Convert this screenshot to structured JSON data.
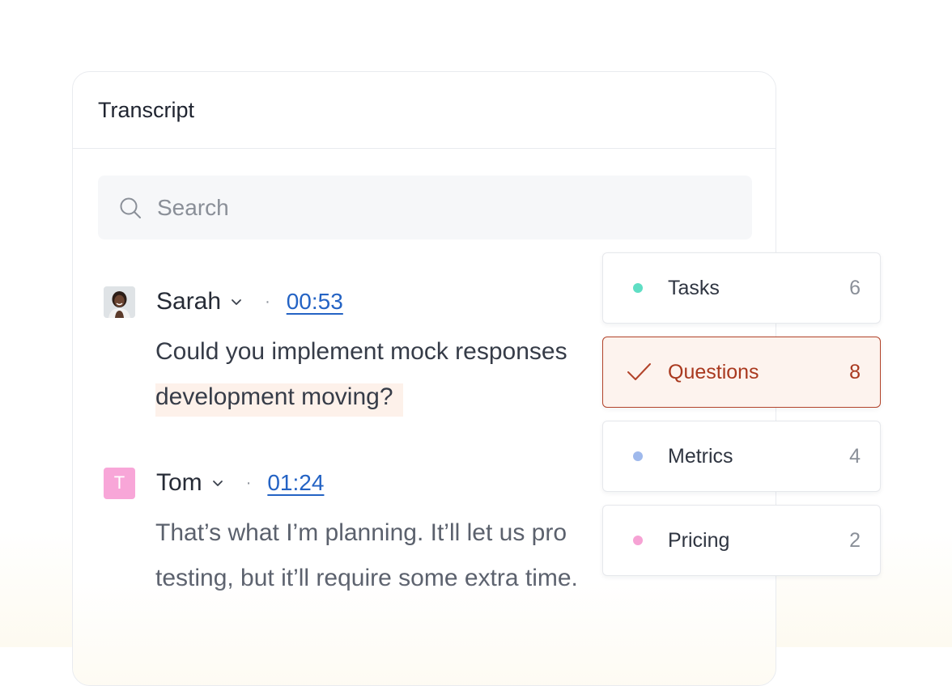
{
  "transcript": {
    "title": "Transcript",
    "search": {
      "placeholder": "Search",
      "value": ""
    },
    "entries": [
      {
        "speaker": "Sarah",
        "avatar": "photo",
        "timestamp": "00:53",
        "line1": "Could you implement mock responses",
        "line2": "development moving?",
        "highlighted": true
      },
      {
        "speaker": "Tom",
        "avatar_initial": "T",
        "avatar_color": "#f8a6d8",
        "timestamp": "01:24",
        "line1": "That’s what I’m planning. It’ll let us pro",
        "line2": "testing, but it’ll require some extra time."
      }
    ]
  },
  "filters": [
    {
      "label": "Tasks",
      "count": "6",
      "color": "#5fdec4",
      "selected": false
    },
    {
      "label": "Questions",
      "count": "8",
      "color": "#b2432a",
      "selected": true,
      "icon": "check-icon"
    },
    {
      "label": "Metrics",
      "count": "4",
      "color": "#9fb9ec",
      "selected": false
    },
    {
      "label": "Pricing",
      "count": "2",
      "color": "#f6a2d4",
      "selected": false
    }
  ],
  "colors": {
    "accent": "#b2432a",
    "link": "#2463c4",
    "highlight": "#fdf1ea"
  }
}
